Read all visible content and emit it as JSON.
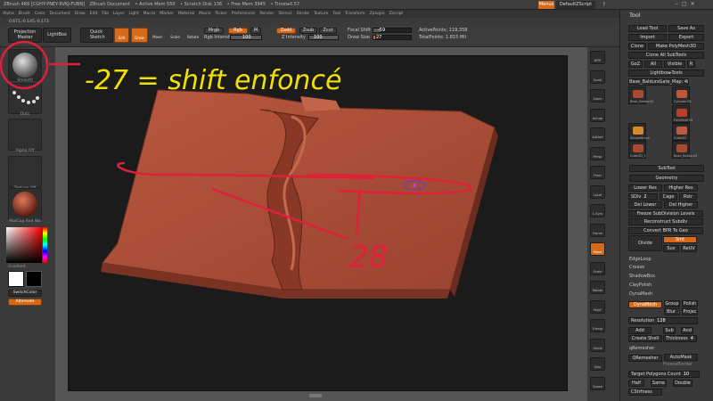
{
  "title_bar": {
    "app": "ZBrush 4R6 [CGHY-PNEY-RVKJ-FUBN]",
    "document": "ZBrush Document",
    "active_mem": "• Active Mem 550",
    "scratch_disk": "• Scratch Disk 136",
    "free_mem": "• Free Mem 3945",
    "timer": "• Timer▸0.57",
    "menus_label": "Menus",
    "script_label": "DefaultZScript"
  },
  "menubar": [
    "Alpha",
    "Brush",
    "Color",
    "Document",
    "Draw",
    "Edit",
    "File",
    "Layer",
    "Light",
    "Macro",
    "Marker",
    "Material",
    "Movie",
    "Picker",
    "Preferences",
    "Render",
    "Stencil",
    "Stroke",
    "Texture",
    "Tool",
    "Transform",
    "Zplugin",
    "Zscript"
  ],
  "coords": "0.671,-0.145,-0.173",
  "toolbar": {
    "projection_master": "Projection Master",
    "lightbox": "LightBox",
    "quick_sketch": "Quick Sketch",
    "edit": "Edit",
    "draw": "Draw",
    "move": "Move",
    "scale": "Scale",
    "rotate": "Rotate",
    "mrgb": "Mrgb",
    "rgb": "Rgb",
    "m": "M",
    "zadd": "Zadd",
    "zsub": "Zsub",
    "zcut": "Zcut",
    "rgb_intensity_label": "Rgb Intensity",
    "rgb_intensity_value": "100",
    "z_intensity_label": "Z Intensity",
    "z_intensity_value": "100",
    "focal_shift_label": "Focal Shift",
    "focal_shift_value": "-59",
    "draw_size_label": "Draw Size",
    "draw_size_value": "27",
    "active_points": "ActivePoints: 119,358",
    "total_points": "TotalPoints: 1.815 Mil"
  },
  "left_shelf": {
    "brush": "Smooth",
    "stroke": "Dots",
    "alpha": "Alpha Off",
    "texture": "Texture Off",
    "material": "MatCap Red Wa",
    "gradient": "Gradient",
    "switch_color": "SwitchColor",
    "alternate": "Alternate"
  },
  "right_shelf": [
    "BPR",
    "Scroll",
    "Zoom",
    "Actual",
    "AAHalf",
    "Persp",
    "Floor",
    "Local",
    "L.Sym",
    "Frame",
    "Move",
    "Scale",
    "Rotate",
    "PolyF",
    "Transp",
    "Ghost",
    "Solo",
    "Xpose"
  ],
  "palette": {
    "title": "Tool",
    "load_tool": "Load Tool",
    "save_as": "Save As",
    "import": "Import",
    "export": "Export",
    "clone": "Clone",
    "make_polymesh": "Make PolyMesh3D",
    "clone_all_subtools": "Clone All SubTools",
    "goz": "GoZ",
    "all": "All",
    "visible": "Visible",
    "r": "R",
    "lightbox_tools": "Lightbox▸Tools",
    "current_tool": "Base_BaldursGate_Map: 48",
    "thumbs": [
      {
        "name": "Base_BaldursG"
      },
      {
        "name": "Cylinder3D"
      },
      {
        "name": "PolyMesh3D"
      },
      {
        "name": "SimpleBrush"
      },
      {
        "name": "Cube3D"
      },
      {
        "name": "Cube3D_1"
      },
      {
        "name": "Base_BaldursG"
      }
    ],
    "subtool": "SubTool",
    "geometry": "Geometry",
    "lower_res": "Lower Res",
    "higher_res": "Higher Res",
    "sdiv_label": "SDiv",
    "sdiv_value": "2",
    "cage": "Cage",
    "rstr": "Rstr",
    "del_lower": "Del Lower",
    "del_higher": "Del Higher",
    "freeze_subdivision": "Freeze SubDivision Levels",
    "reconstruct_subdiv": "Reconstruct Subdiv",
    "convert_bpr": "Convert BPR To Geo",
    "divide": "Divide",
    "smt": "Smt",
    "suv": "Suv",
    "reuv": "ReUV",
    "edgeloop": "EdgeLoop",
    "crease": "Crease",
    "shadowbox": "ShadowBox",
    "claypolish": "ClayPolish",
    "dynamesh_section": "DynaMesh",
    "dynamesh_btn": "DynaMesh",
    "group": "Group",
    "polish": "Polish",
    "blur_label": "Blur",
    "blur_value": "2",
    "project": "Projec",
    "resolution_label": "Resolution",
    "resolution_value": "128",
    "add": "Add",
    "sub": "Sub",
    "and": "And",
    "create_shell": "Create Shell",
    "thickness_label": "Thickness",
    "thickness_value": "4",
    "qremesher_section": "qRemesher",
    "qremesher_btn": "QRemesher",
    "automask": "AutoMask",
    "freeze_border": "FreezeBorder",
    "target_polygons_label": "Target Polygons Count",
    "target_polygons_value": "10",
    "half": "Half",
    "same": "Same",
    "double": "Double",
    "adapt": "Adapt",
    "curve_strength_label": "CStrfness"
  },
  "annotations": {
    "note_top": "-27 = shift enfoncé",
    "note_bottom": "28"
  },
  "colors": {
    "accent": "#d66a1b",
    "model": "#b4533a",
    "annotation_red": "#e0203a",
    "annotation_yellow": "#f2e000"
  }
}
